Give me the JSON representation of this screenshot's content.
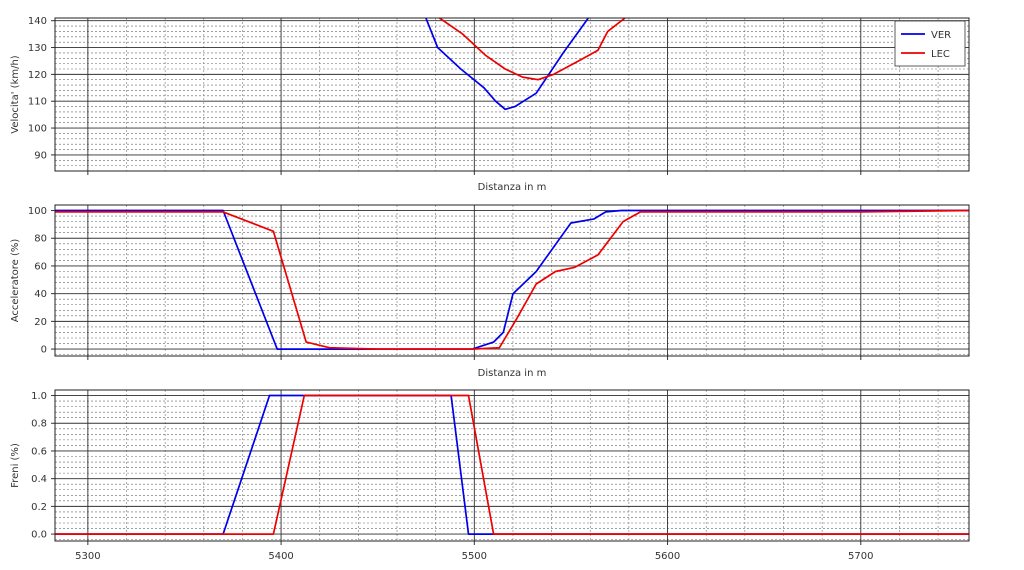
{
  "chart_data": [
    {
      "type": "line",
      "ylabel": "Velocita' (km/h)",
      "xlabel": "Distanza in m",
      "xlim": [
        5283,
        5756
      ],
      "ylim": [
        84,
        141
      ],
      "yticks": [
        90,
        100,
        110,
        120,
        130,
        140
      ],
      "xticks": [
        5300,
        5400,
        5500,
        5600,
        5700
      ],
      "show_xticklabels": false,
      "legend": "top-right",
      "series": [
        {
          "name": "VER",
          "color": "#0000ee",
          "x": [
            5470,
            5481,
            5493,
            5505,
            5511,
            5516,
            5521,
            5532,
            5546,
            5555,
            5561,
            5566
          ],
          "y": [
            150,
            130,
            122,
            115,
            110,
            107,
            108,
            113,
            128,
            137,
            143,
            148
          ]
        },
        {
          "name": "LEC",
          "color": "#ee0000",
          "x": [
            5453,
            5465,
            5482,
            5494,
            5506,
            5516,
            5525,
            5533,
            5541,
            5554,
            5564,
            5569,
            5578,
            5586
          ],
          "y": [
            160,
            152,
            141,
            135,
            127,
            122,
            119,
            118,
            120,
            125,
            129,
            136,
            141,
            147
          ]
        }
      ]
    },
    {
      "type": "line",
      "ylabel": "Acceleratore (%)",
      "xlabel": "Distanza in m",
      "xlim": [
        5283,
        5756
      ],
      "ylim": [
        -5,
        104
      ],
      "yticks": [
        0,
        20,
        40,
        60,
        80,
        100
      ],
      "xticks": [
        5300,
        5400,
        5500,
        5600,
        5700
      ],
      "show_xticklabels": false,
      "series": [
        {
          "name": "VER",
          "color": "#0000ee",
          "x": [
            5283,
            5370,
            5398,
            5470,
            5499,
            5510,
            5515,
            5520,
            5532,
            5550,
            5562,
            5568,
            5576,
            5756
          ],
          "y": [
            100,
            100,
            0,
            0,
            0,
            5,
            12,
            40,
            56,
            91,
            94,
            99,
            100,
            100
          ]
        },
        {
          "name": "LEC",
          "color": "#ee0000",
          "x": [
            5283,
            5370,
            5396,
            5413,
            5425,
            5450,
            5499,
            5513,
            5522,
            5532,
            5542,
            5552,
            5564,
            5577,
            5586,
            5650,
            5700,
            5756
          ],
          "y": [
            99,
            99,
            85,
            5,
            1,
            0,
            0,
            1,
            22,
            47,
            56,
            59,
            68,
            92,
            99,
            99,
            99,
            100
          ]
        }
      ]
    },
    {
      "type": "line",
      "ylabel": "Freni (%)",
      "xlabel": "",
      "xlim": [
        5283,
        5756
      ],
      "ylim": [
        -0.05,
        1.04
      ],
      "yticks": [
        "0.0",
        "0.2",
        "0.4",
        "0.6",
        "0.8",
        "1.0"
      ],
      "xticks": [
        5300,
        5400,
        5500,
        5600,
        5700
      ],
      "show_xticklabels": true,
      "series": [
        {
          "name": "VER",
          "color": "#0000ee",
          "x": [
            5283,
            5370,
            5394,
            5480,
            5488,
            5497,
            5756
          ],
          "y": [
            0,
            0,
            1,
            1,
            1,
            0,
            0
          ]
        },
        {
          "name": "LEC",
          "color": "#ee0000",
          "x": [
            5283,
            5396,
            5412,
            5493,
            5497,
            5510,
            5756
          ],
          "y": [
            0,
            0,
            1,
            1,
            1,
            0,
            0
          ]
        }
      ]
    }
  ]
}
